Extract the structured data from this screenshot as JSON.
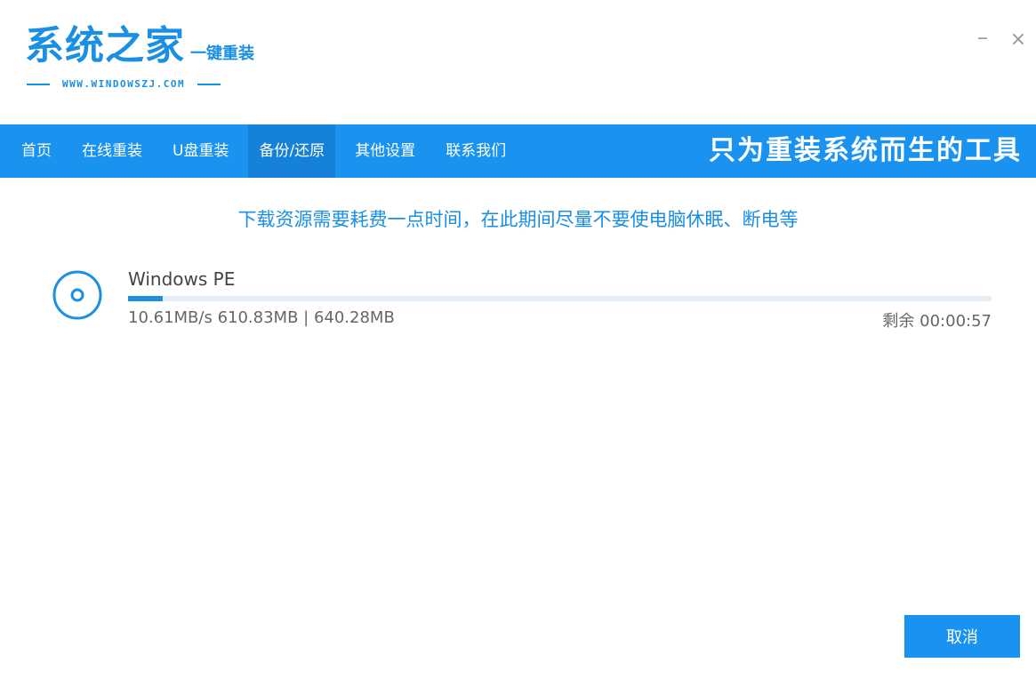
{
  "header": {
    "title": "系统之家",
    "subtitle": "一键重装",
    "url": "WWW.WINDOWSZJ.COM",
    "minimize_symbol": "–",
    "close_symbol": "×"
  },
  "nav": {
    "tabs": [
      {
        "label": "首页"
      },
      {
        "label": "在线重装"
      },
      {
        "label": "U盘重装"
      },
      {
        "label": "备份/还原",
        "active": true
      },
      {
        "label": "其他设置"
      },
      {
        "label": "联系我们"
      }
    ],
    "slogan": "只为重装系统而生的工具"
  },
  "notice": "下载资源需要耗费一点时间，在此期间尽量不要使电脑休眠、断电等",
  "download": {
    "icon": "disc-icon",
    "name": "Windows PE",
    "speed_and_size": "10.61MB/s 610.83MB | 640.28MB",
    "remaining": "剩余 00:00:57",
    "progress_fraction": 0.04
  },
  "actions": {
    "cancel_label": "取消"
  },
  "colors": {
    "accent": "#1a8fe3",
    "navbar": "#1a92f0",
    "nav_active": "#1681d8"
  }
}
